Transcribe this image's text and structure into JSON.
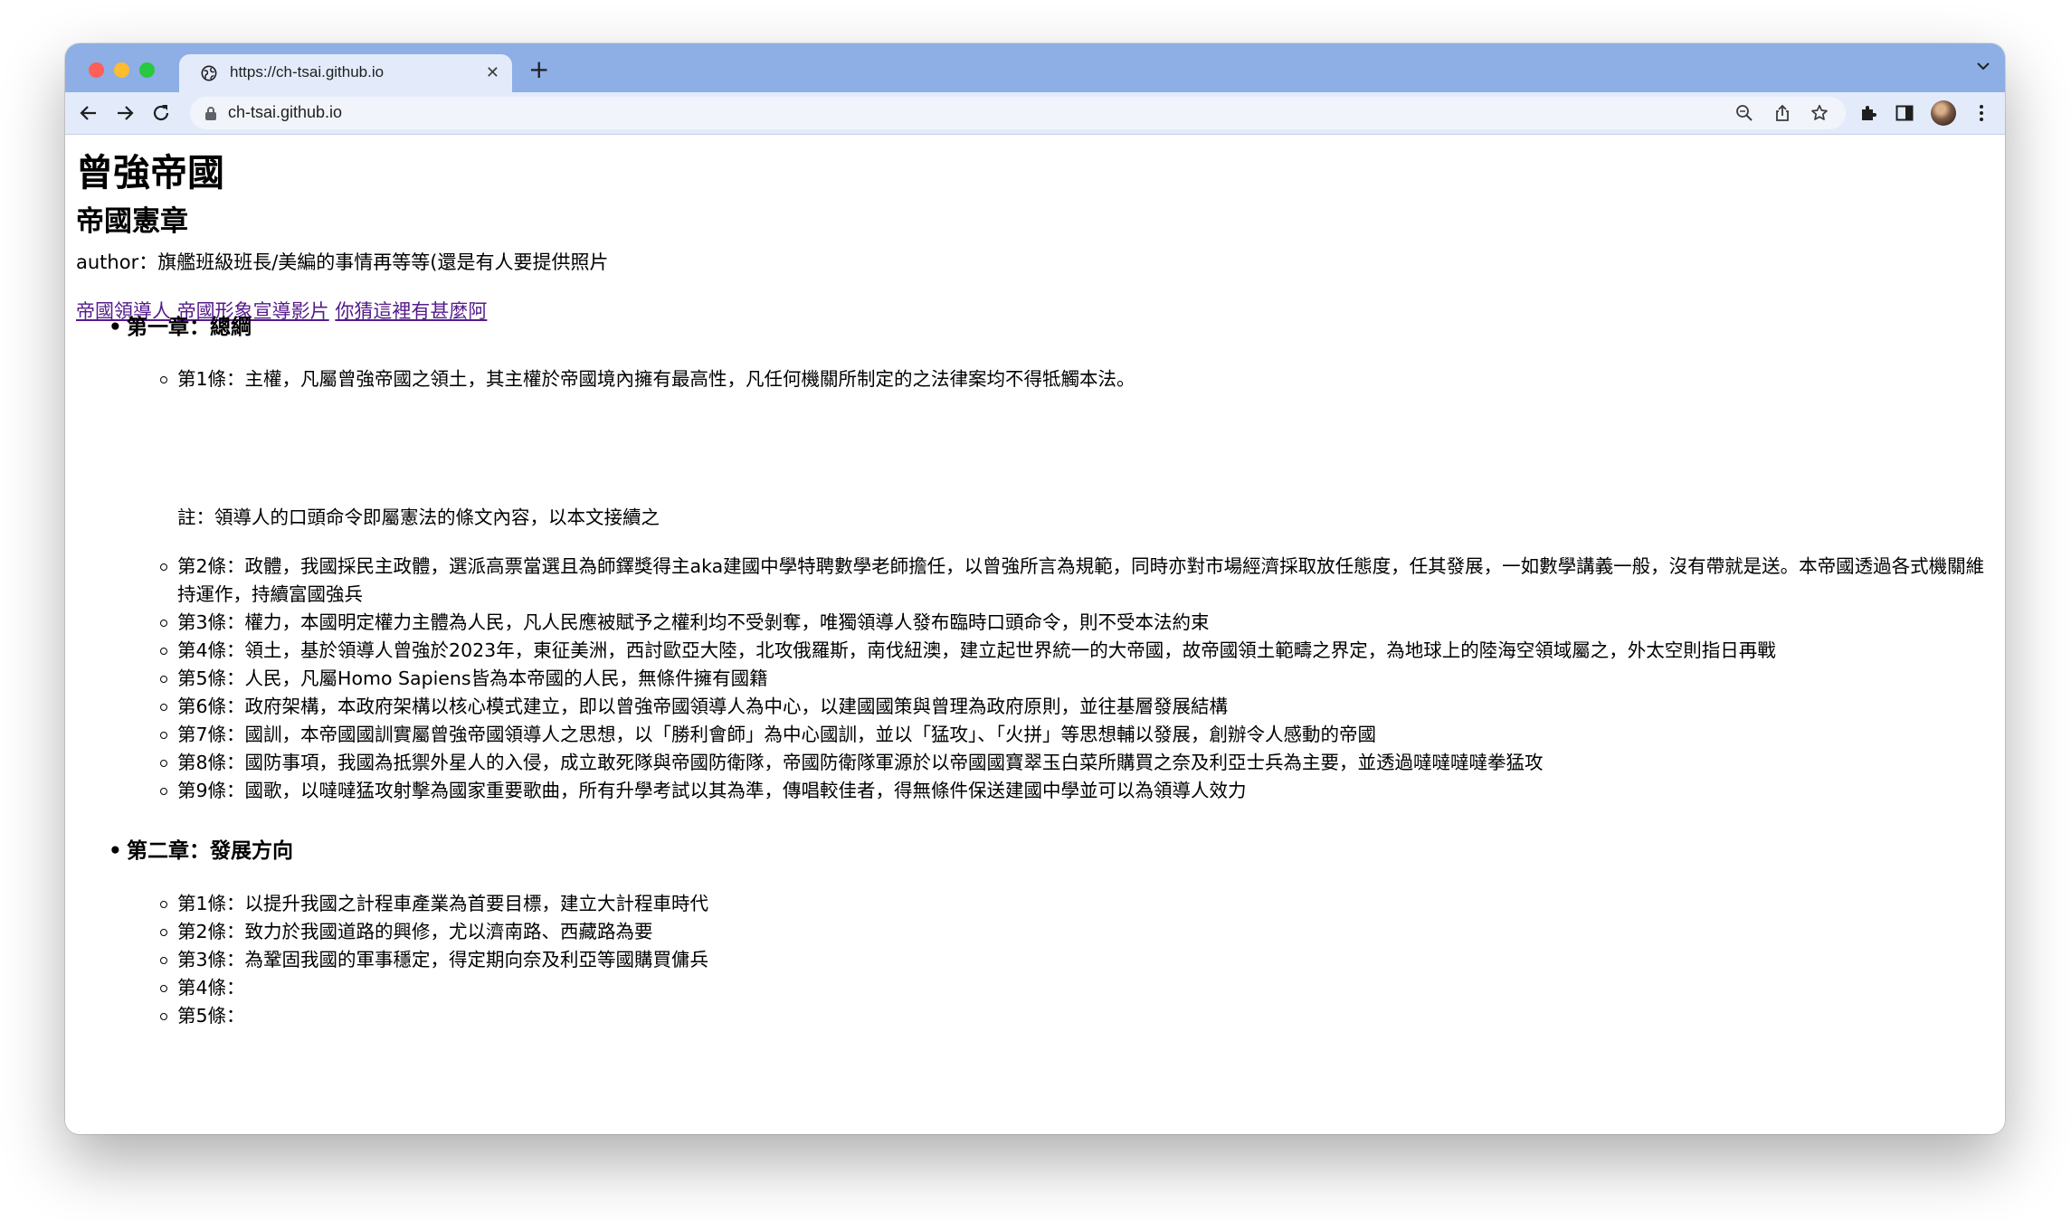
{
  "browser": {
    "tab_title": "https://ch-tsai.github.io",
    "address": "ch-tsai.github.io"
  },
  "page": {
    "title": "曾強帝國",
    "subtitle": "帝國憲章",
    "author": "author：旗艦班級班長/美編的事情再等等(還是有人要提供照片",
    "links": [
      "帝國領導人",
      "帝國形象宣導影片",
      "你猜這裡有甚麼阿"
    ],
    "chapter1": {
      "title": "第一章：總綱",
      "a1": "第1條：主權，凡屬曾強帝國之領土，其主權於帝國境內擁有最高性，凡任何機關所制定的之法律案均不得牴觸本法。",
      "note": "註：領導人的口頭命令即屬憲法的條文內容，以本文接續之",
      "a2": "第2條：政體，我國採民主政體，選派高票當選且為師鐸獎得主aka建國中學特聘數學老師擔任，以曾強所言為規範，同時亦對市場經濟採取放任態度，任其發展，一如數學講義一般，沒有帶就是送。本帝國透過各式機關維持運作，持續富國強兵",
      "a3": "第3條：權力，本國明定權力主體為人民，凡人民應被賦予之權利均不受剝奪，唯獨領導人發布臨時口頭命令，則不受本法約束",
      "a4": "第4條：領土，基於領導人曾強於2023年，東征美洲，西討歐亞大陸，北攻俄羅斯，南伐紐澳，建立起世界統一的大帝國，故帝國領土範疇之界定，為地球上的陸海空領域屬之，外太空則指日再戰",
      "a5": "第5條：人民，凡屬Homo Sapiens皆為本帝國的人民，無條件擁有國籍",
      "a6": "第6條：政府架構，本政府架構以核心模式建立，即以曾強帝國領導人為中心，以建國國策與曾理為政府原則，並往基層發展結構",
      "a7": "第7條：國訓，本帝國國訓實屬曾強帝國領導人之思想，以「勝利會師」為中心國訓，並以「猛攻」、「火拼」等思想輔以發展，創辦令人感動的帝國",
      "a8": "第8條：國防事項，我國為抵禦外星人的入侵，成立敢死隊與帝國防衛隊，帝國防衛隊軍源於以帝國國寶翠玉白菜所購買之奈及利亞士兵為主要，並透過噠噠噠噠拳猛攻",
      "a9": "第9條：國歌，以噠噠猛攻射擊為國家重要歌曲，所有升學考試以其為準，傳唱較佳者，得無條件保送建國中學並可以為領導人效力"
    },
    "chapter2": {
      "title": "第二章：發展方向",
      "a1": "第1條：以提升我國之計程車產業為首要目標，建立大計程車時代",
      "a2": "第2條：致力於我國道路的興修，尤以濟南路、西藏路為要",
      "a3": "第3條：為鞏固我國的軍事穩定，得定期向奈及利亞等國購買傭兵",
      "a4": "第4條：",
      "a5": "第5條："
    }
  }
}
